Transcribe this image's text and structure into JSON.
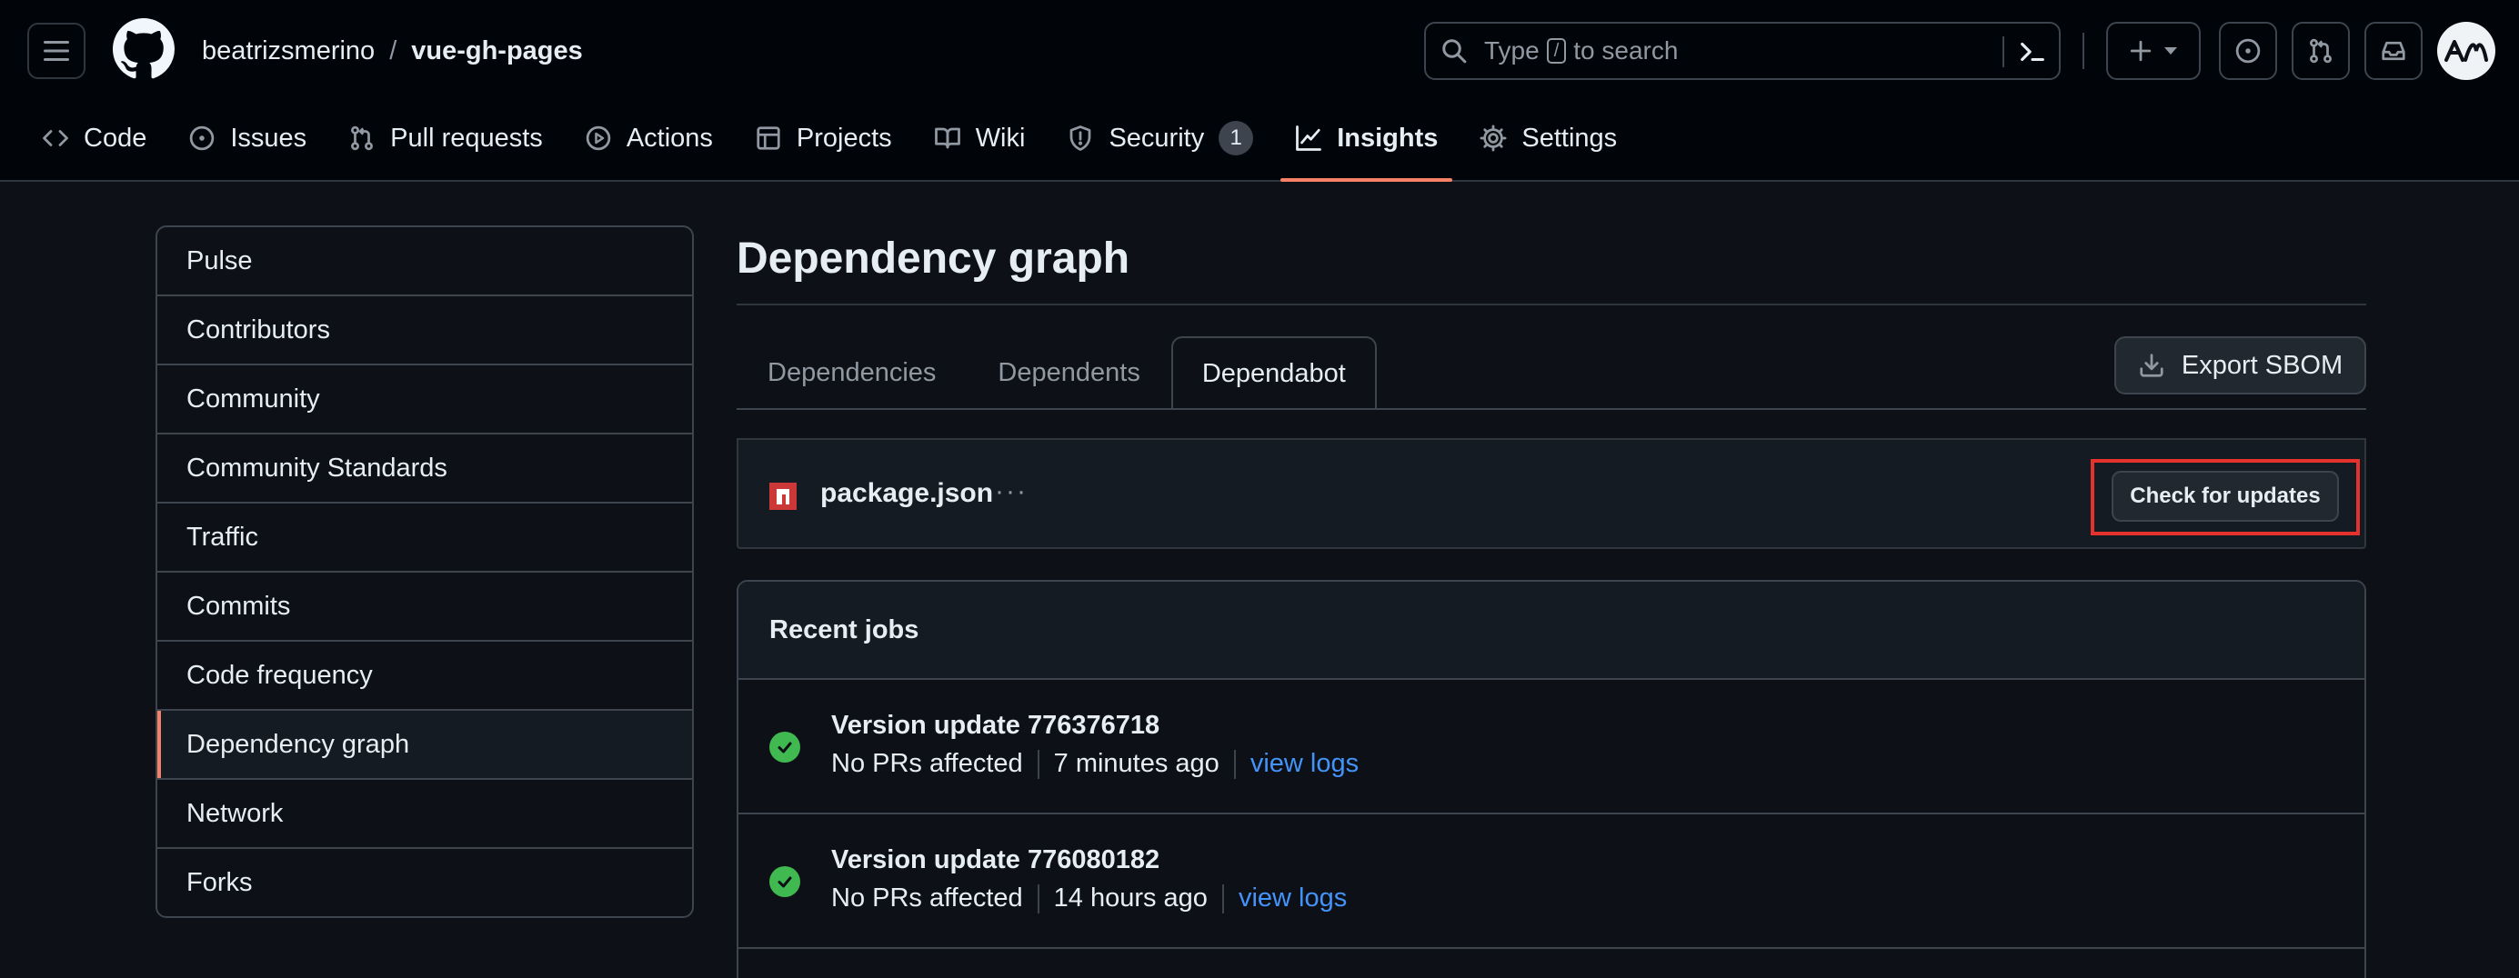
{
  "header": {
    "owner": "beatrizsmerino",
    "separator": "/",
    "repo": "vue-gh-pages",
    "search": {
      "prefix": "Type",
      "key": "/",
      "suffix": "to search"
    }
  },
  "repo_nav": [
    {
      "label": "Code",
      "icon": "code-icon"
    },
    {
      "label": "Issues",
      "icon": "issue-opened-icon"
    },
    {
      "label": "Pull requests",
      "icon": "git-pull-request-icon"
    },
    {
      "label": "Actions",
      "icon": "play-icon"
    },
    {
      "label": "Projects",
      "icon": "table-icon"
    },
    {
      "label": "Wiki",
      "icon": "book-icon"
    },
    {
      "label": "Security",
      "icon": "shield-icon",
      "count": "1"
    },
    {
      "label": "Insights",
      "icon": "graph-icon",
      "active": true
    },
    {
      "label": "Settings",
      "icon": "gear-icon"
    }
  ],
  "sidebar": {
    "items": [
      {
        "label": "Pulse"
      },
      {
        "label": "Contributors"
      },
      {
        "label": "Community"
      },
      {
        "label": "Community Standards"
      },
      {
        "label": "Traffic"
      },
      {
        "label": "Commits"
      },
      {
        "label": "Code frequency"
      },
      {
        "label": "Dependency graph",
        "selected": true
      },
      {
        "label": "Network"
      },
      {
        "label": "Forks"
      }
    ]
  },
  "main": {
    "title": "Dependency graph",
    "tabs": [
      {
        "label": "Dependencies"
      },
      {
        "label": "Dependents"
      },
      {
        "label": "Dependabot",
        "active": true
      }
    ],
    "export_label": "Export SBOM",
    "manifest": {
      "name": "package.json",
      "more": "···",
      "check_label": "Check for updates"
    },
    "recent_jobs": {
      "title": "Recent jobs",
      "jobs": [
        {
          "title": "Version update 776376718",
          "status": "No PRs affected",
          "time": "7 minutes ago",
          "link": "view logs"
        },
        {
          "title": "Version update 776080182",
          "status": "No PRs affected",
          "time": "14 hours ago",
          "link": "view logs"
        }
      ]
    }
  },
  "colors": {
    "background": "#0d1117",
    "header": "#010409",
    "accent_underline": "#f78166",
    "link": "#4493f8",
    "success": "#3fb950",
    "highlight": "#e5322d"
  }
}
